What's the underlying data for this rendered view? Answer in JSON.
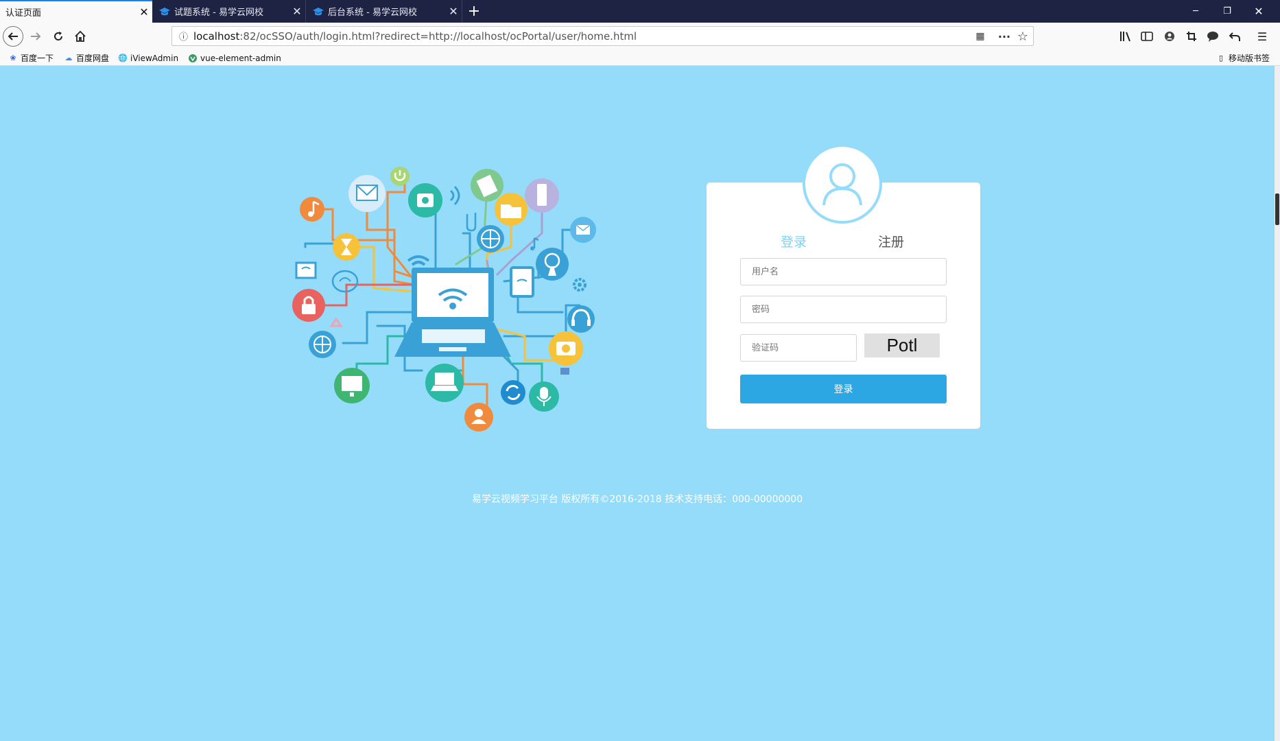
{
  "browser": {
    "tabs": [
      {
        "label": "认证页面",
        "active": true
      },
      {
        "label": "试题系统 - 易学云网校",
        "active": false
      },
      {
        "label": "后台系统 - 易学云网校",
        "active": false
      }
    ],
    "url": {
      "host": "localhost",
      "path": ":82/ocSSO/auth/login.html?redirect=http://localhost/ocPortal/user/home.html"
    },
    "bookmarks": [
      "百度一下",
      "百度网盘",
      "iViewAdmin",
      "vue-element-admin"
    ],
    "mobile_bookmarks": "移动版书签",
    "colors": {
      "tabbar": "#1e2344",
      "active_tab_line": "#0a84ff"
    }
  },
  "login": {
    "tab_login": "登录",
    "tab_register": "注册",
    "username_placeholder": "用户名",
    "password_placeholder": "密码",
    "captcha_placeholder": "验证码",
    "captcha_text": "Potl",
    "submit_label": "登录",
    "colors": {
      "page_bg": "#94dcfa",
      "button": "#2ca7e3",
      "active_tab": "#7cd3f5"
    }
  },
  "footer": {
    "text": "易学云视频学习平台 版权所有©2016-2018 技术支持电话：000-00000000"
  }
}
